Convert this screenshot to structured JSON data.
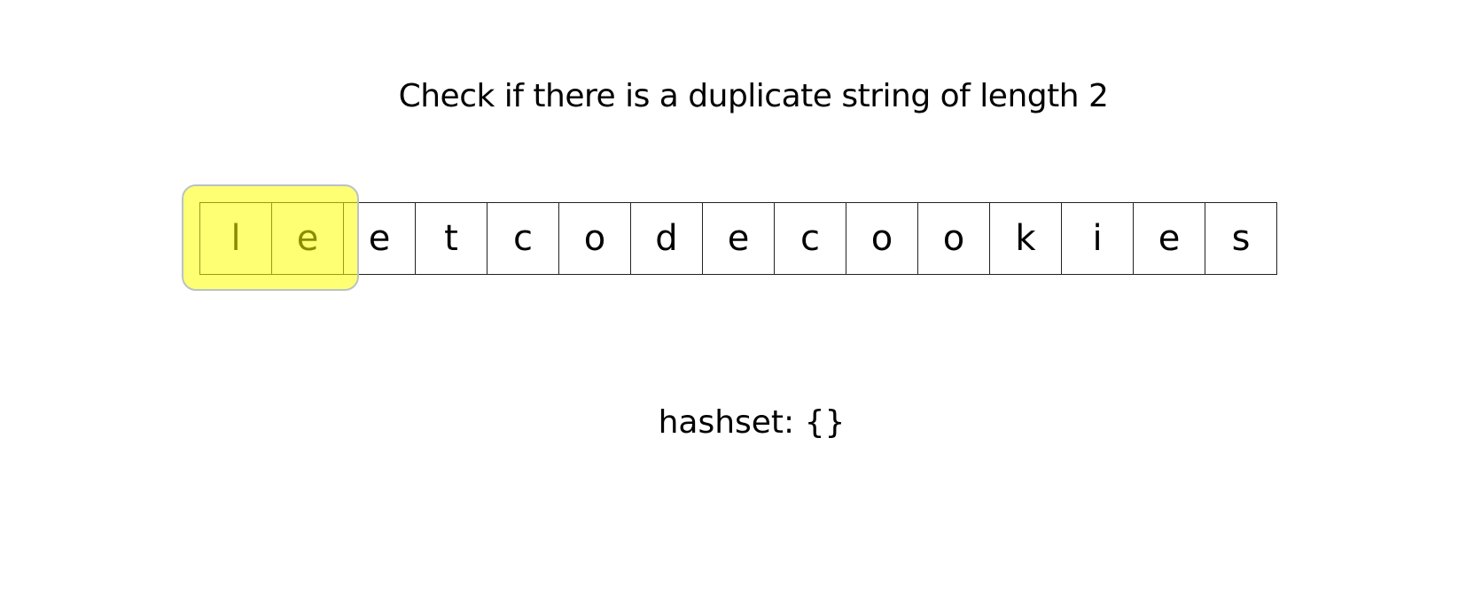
{
  "title": "Check if there is a duplicate string of length 2",
  "characters": [
    "l",
    "e",
    "e",
    "t",
    "c",
    "o",
    "d",
    "e",
    "c",
    "o",
    "o",
    "k",
    "i",
    "e",
    "s"
  ],
  "window": {
    "start_index": 0,
    "length": 2,
    "color": "#ffff00"
  },
  "hashset": {
    "label": "hashset: {}"
  }
}
